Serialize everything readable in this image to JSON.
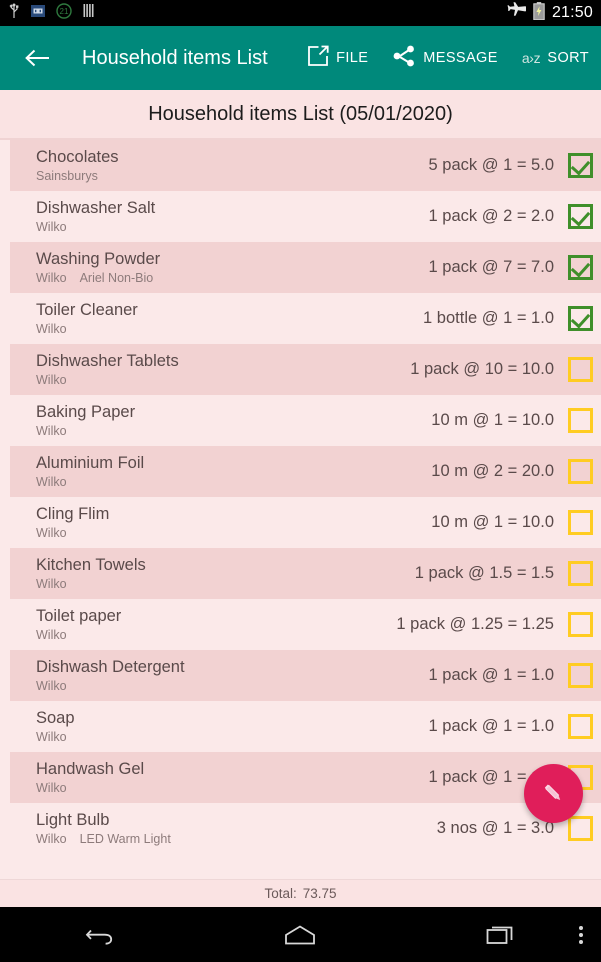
{
  "statusbar": {
    "icons": [
      "usb-icon",
      "sd-card-icon",
      "alarm-badge-icon",
      "sim-icon"
    ],
    "alarm_badge": "21",
    "right_icons": [
      "airplane-mode-icon",
      "battery-charging-icon"
    ],
    "clock": "21:50"
  },
  "toolbar": {
    "back_label": "back-arrow",
    "title": "Household items List",
    "actions": [
      {
        "id": "file",
        "label": "FILE",
        "icon": "export-file-icon"
      },
      {
        "id": "message",
        "label": "MESSAGE",
        "icon": "share-nodes-icon"
      },
      {
        "id": "sort",
        "label": "SORT",
        "icon": "a-to-z-icon",
        "icon_text": "a›z"
      }
    ]
  },
  "list_header": {
    "title": "Household items List (05/01/2020)"
  },
  "items": [
    {
      "name": "Chocolates",
      "store": "Sainsburys",
      "note": "",
      "qty": "5 pack @ 1 = 5.0",
      "checked": true
    },
    {
      "name": "Dishwasher Salt",
      "store": "Wilko",
      "note": "",
      "qty": "1 pack @ 2 = 2.0",
      "checked": true
    },
    {
      "name": "Washing Powder",
      "store": "Wilko",
      "note": "Ariel Non-Bio",
      "qty": "1 pack @ 7 = 7.0",
      "checked": true
    },
    {
      "name": "Toiler Cleaner",
      "store": "Wilko",
      "note": "",
      "qty": "1 bottle @ 1 = 1.0",
      "checked": true
    },
    {
      "name": "Dishwasher Tablets",
      "store": "Wilko",
      "note": "",
      "qty": "1 pack @ 10 = 10.0",
      "checked": false
    },
    {
      "name": "Baking Paper",
      "store": "Wilko",
      "note": "",
      "qty": "10 m @ 1 = 10.0",
      "checked": false
    },
    {
      "name": "Aluminium Foil",
      "store": "Wilko",
      "note": "",
      "qty": "10 m @ 2 = 20.0",
      "checked": false
    },
    {
      "name": "Cling Flim",
      "store": "Wilko",
      "note": "",
      "qty": "10 m @ 1 = 10.0",
      "checked": false
    },
    {
      "name": "Kitchen Towels",
      "store": "Wilko",
      "note": "",
      "qty": "1 pack @ 1.5 = 1.5",
      "checked": false
    },
    {
      "name": "Toilet paper",
      "store": "Wilko",
      "note": "",
      "qty": "1 pack @ 1.25 = 1.25",
      "checked": false
    },
    {
      "name": "Dishwash Detergent",
      "store": "Wilko",
      "note": "",
      "qty": "1 pack @ 1 = 1.0",
      "checked": false
    },
    {
      "name": "Soap",
      "store": "Wilko",
      "note": "",
      "qty": "1 pack @ 1 = 1.0",
      "checked": false
    },
    {
      "name": "Handwash Gel",
      "store": "Wilko",
      "note": "",
      "qty": "1 pack @ 1 = 1.0",
      "checked": false
    },
    {
      "name": "Light Bulb",
      "store": "Wilko",
      "note": "LED Warm Light",
      "qty": "3 nos @ 1 = 3.0",
      "checked": false
    }
  ],
  "footer": {
    "total_label": "Total:",
    "total_value": "73.75"
  },
  "fab": {
    "icon": "pencil-edit-icon"
  },
  "navbar": {
    "buttons": [
      "back-nav-icon",
      "home-nav-icon",
      "recents-nav-icon",
      "overflow-menu-icon"
    ]
  },
  "colors": {
    "toolbar": "#00897b",
    "row_alt": "#f2d2d2",
    "row_plain": "#fbe9e9",
    "header_bg": "#fae3e3",
    "checkbox_checked": "#3f8f2a",
    "checkbox_unchecked": "#ffcc22",
    "fab": "#e01e5a"
  }
}
